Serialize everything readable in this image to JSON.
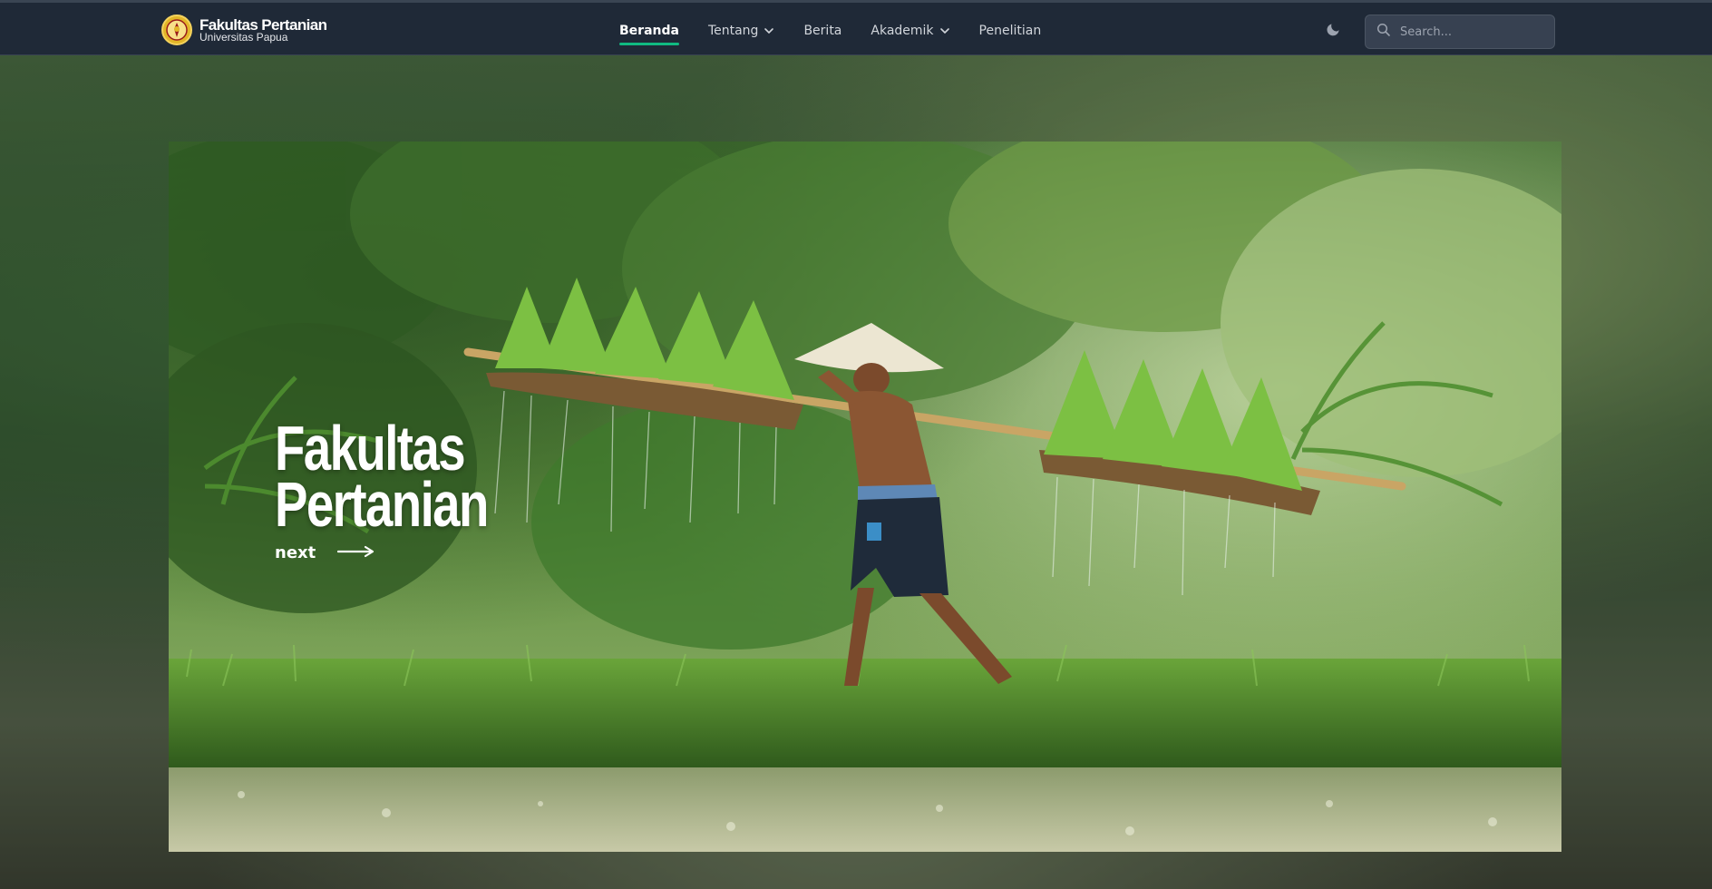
{
  "brand": {
    "title": "Fakultas Pertanian",
    "subtitle": "Universitas Papua",
    "logo_icon": "university-seal-icon"
  },
  "nav": {
    "items": [
      {
        "label": "Beranda",
        "active": true,
        "dropdown": false
      },
      {
        "label": "Tentang",
        "active": false,
        "dropdown": true
      },
      {
        "label": "Berita",
        "active": false,
        "dropdown": false
      },
      {
        "label": "Akademik",
        "active": false,
        "dropdown": true
      },
      {
        "label": "Penelitian",
        "active": false,
        "dropdown": false
      }
    ]
  },
  "theme_toggle": {
    "icon": "moon-icon"
  },
  "search": {
    "placeholder": "Search...",
    "value": "",
    "icon": "search-icon"
  },
  "hero": {
    "title_line1": "Fakultas",
    "title_line2": "Pertanian",
    "next_label": "next",
    "next_icon": "arrow-right-icon",
    "image": "farmer carrying rice seedlings on a bamboo pole"
  },
  "colors": {
    "navbar_bg": "#1f2937",
    "active_underline": "#10b981",
    "brand_logo": "#e2b628"
  }
}
